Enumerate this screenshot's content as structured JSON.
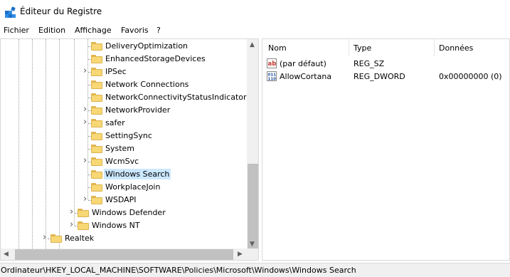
{
  "window": {
    "title": "Éditeur du Registre",
    "icon": "registry-editor-icon"
  },
  "menu": [
    "Fichier",
    "Edition",
    "Affichage",
    "Favoris",
    "?"
  ],
  "tree": [
    {
      "label": "DeliveryOptimization",
      "expandable": false
    },
    {
      "label": "EnhancedStorageDevices",
      "expandable": false
    },
    {
      "label": "IPSec",
      "expandable": true
    },
    {
      "label": "Network Connections",
      "expandable": false
    },
    {
      "label": "NetworkConnectivityStatusIndicator",
      "expandable": false
    },
    {
      "label": "NetworkProvider",
      "expandable": true
    },
    {
      "label": "safer",
      "expandable": true
    },
    {
      "label": "SettingSync",
      "expandable": false
    },
    {
      "label": "System",
      "expandable": false
    },
    {
      "label": "WcmSvc",
      "expandable": true
    },
    {
      "label": "Windows Search",
      "expandable": false,
      "selected": true
    },
    {
      "label": "WorkplaceJoin",
      "expandable": false
    },
    {
      "label": "WSDAPI",
      "expandable": true
    },
    {
      "label": "Windows Defender",
      "expandable": true
    },
    {
      "label": "Windows NT",
      "expandable": true
    },
    {
      "label": "Realtek",
      "expandable": true
    }
  ],
  "list": {
    "columns": [
      "Nom",
      "Type",
      "Données"
    ],
    "rows": [
      {
        "icon": "string-value-icon",
        "name": "(par défaut)",
        "type": "REG_SZ",
        "data": ""
      },
      {
        "icon": "binary-value-icon",
        "name": "AllowCortana",
        "type": "REG_DWORD",
        "data": "0x00000000 (0)"
      }
    ]
  },
  "status": {
    "path": "Ordinateur\\HKEY_LOCAL_MACHINE\\SOFTWARE\\Policies\\Microsoft\\Windows\\Windows Search"
  },
  "colors": {
    "selection": "#cce8ff",
    "folder": "#f8d775",
    "scrollbar": "#c1c1c1"
  }
}
